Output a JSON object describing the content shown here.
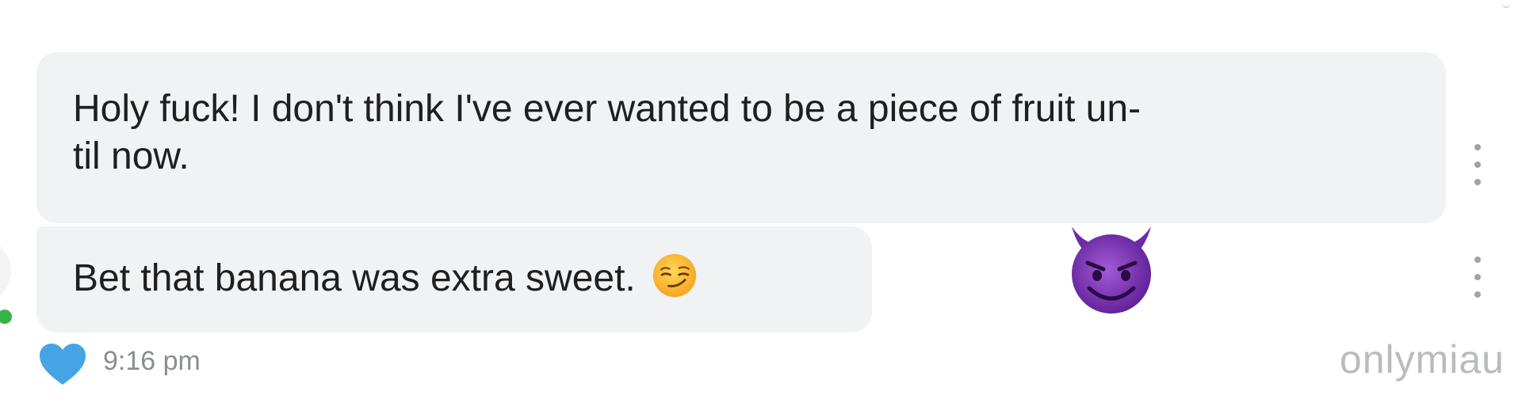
{
  "messages": [
    {
      "text": "Holy fuck! I don't think I've ever wanted to be a piece of fruit un- til now.",
      "line1": "Holy fuck! I don't think I've ever wanted to be a piece of fruit un-",
      "line2": "til now."
    },
    {
      "text": "Bet that banana was extra sweet.",
      "emoji": "smirking-face"
    }
  ],
  "reaction_emoji": "smiling-face-with-horns",
  "timestamp": "9:16 pm",
  "liked": true,
  "watermark": "onlymiau",
  "colors": {
    "bubble_bg": "#f1f2f4",
    "heart": "#45a4e4",
    "online": "#35b34a",
    "timestamp": "#8a8d93",
    "watermark": "#b9bbbe"
  }
}
